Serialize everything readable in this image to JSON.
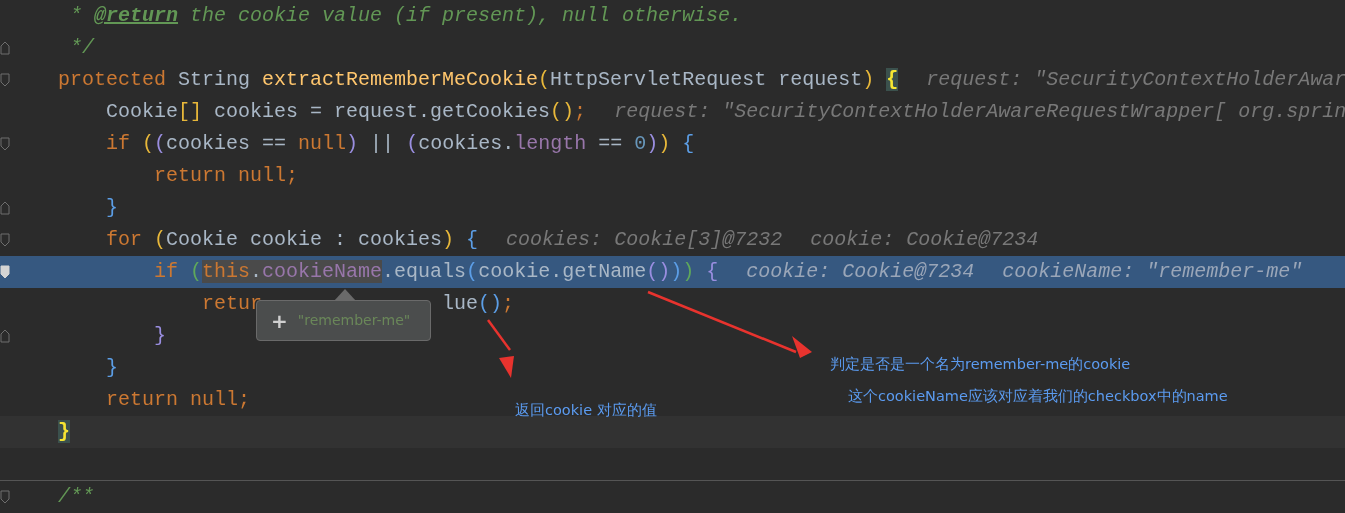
{
  "editor": {
    "lines": [
      {
        "tokens": [
          {
            "text": " * ",
            "kind": "doc"
          },
          {
            "text": "@return",
            "kind": "tag"
          },
          {
            "text": " the cookie value (if present), null otherwise.",
            "kind": "doc"
          }
        ]
      },
      {
        "fold_end": true,
        "tokens": [
          {
            "text": " */",
            "kind": "doc"
          }
        ]
      },
      {
        "fold_start": true,
        "tokens": [
          {
            "text": "protected ",
            "kind": "kw"
          },
          {
            "text": "String ",
            "kind": "pl"
          },
          {
            "text": "extractRememberMeCookie",
            "kind": "fn"
          },
          {
            "text": "(",
            "kind": "y"
          },
          {
            "text": "HttpServletRequest request",
            "kind": "pl"
          },
          {
            "text": ") ",
            "kind": "y"
          },
          {
            "text": "{",
            "kind": "match"
          }
        ],
        "hints": [
          "request: \"SecurityContextHolderAwar"
        ],
        "children": [
          {
            "tokens": [
              {
                "text": "Cookie",
                "kind": "pl"
              },
              {
                "text": "[]",
                "kind": "y"
              },
              {
                "text": " cookies = request.getCookies",
                "kind": "pl"
              },
              {
                "text": "()",
                "kind": "y"
              },
              {
                "text": ";",
                "kind": "kw"
              }
            ],
            "hints": [
              "request: \"SecurityContextHolderAwareRequestWrapper[ org.sprin"
            ]
          },
          {
            "fold_start": true,
            "tokens": [
              {
                "text": "if ",
                "kind": "kw"
              },
              {
                "text": "(",
                "kind": "y"
              },
              {
                "text": "(",
                "kind": "p"
              },
              {
                "text": "cookies == ",
                "kind": "pl"
              },
              {
                "text": "null",
                "kind": "kw"
              },
              {
                "text": ")",
                "kind": "p"
              },
              {
                "text": " || ",
                "kind": "pl"
              },
              {
                "text": "(",
                "kind": "p"
              },
              {
                "text": "cookies.",
                "kind": "pl"
              },
              {
                "text": "length",
                "kind": "fld"
              },
              {
                "text": " == ",
                "kind": "pl"
              },
              {
                "text": "0",
                "kind": "num"
              },
              {
                "text": ")",
                "kind": "p"
              },
              {
                "text": ")",
                "kind": "y"
              },
              {
                "text": " {",
                "kind": "b"
              }
            ],
            "children": [
              {
                "tokens": [
                  {
                    "text": "return null",
                    "kind": "kw"
                  },
                  {
                    "text": ";",
                    "kind": "kw"
                  }
                ]
              }
            ]
          },
          {
            "fold_end": true,
            "tokens": [
              {
                "text": "}",
                "kind": "b"
              }
            ]
          },
          {
            "fold_start": true,
            "tokens": [
              {
                "text": "for ",
                "kind": "kw"
              },
              {
                "text": "(",
                "kind": "y"
              },
              {
                "text": "Cookie cookie : cookies",
                "kind": "pl"
              },
              {
                "text": ")",
                "kind": "y"
              },
              {
                "text": " {",
                "kind": "b"
              }
            ],
            "hints": [
              "cookies: Cookie[3]@7232",
              "cookie: Cookie@7234"
            ],
            "children": [
              {
                "fold_start": true,
                "highlighted": true,
                "tokens": [
                  {
                    "text": "if ",
                    "kind": "kw"
                  },
                  {
                    "text": "(",
                    "kind": "g"
                  },
                  {
                    "text": "this",
                    "kind": "kw",
                    "hovered": true
                  },
                  {
                    "text": ".",
                    "kind": "pl",
                    "hovered": true
                  },
                  {
                    "text": "cookieName",
                    "kind": "fld",
                    "hovered": true
                  },
                  {
                    "text": ".equals",
                    "kind": "pl"
                  },
                  {
                    "text": "(",
                    "kind": "b"
                  },
                  {
                    "text": "cookie.getName",
                    "kind": "pl"
                  },
                  {
                    "text": "()",
                    "kind": "p"
                  },
                  {
                    "text": ")",
                    "kind": "b"
                  },
                  {
                    "text": ")",
                    "kind": "g"
                  },
                  {
                    "text": " {",
                    "kind": "p"
                  }
                ],
                "hints": [
                  "cookie: Cookie@7234",
                  "cookieName: \"remember-me\""
                ],
                "children": [
                  {
                    "tokens": [
                      {
                        "text": "retur",
                        "kind": "kw"
                      },
                      {
                        "kind": "gap"
                      },
                      {
                        "text": "lue",
                        "kind": "pl"
                      },
                      {
                        "text": "()",
                        "kind": "b"
                      },
                      {
                        "text": ";",
                        "kind": "kw"
                      }
                    ]
                  }
                ]
              },
              {
                "fold_end": true,
                "tokens": [
                  {
                    "text": "}",
                    "kind": "p"
                  }
                ]
              }
            ]
          },
          {
            "tokens": [
              {
                "text": "}",
                "kind": "b"
              }
            ]
          },
          {
            "tokens": [
              {
                "text": "return null",
                "kind": "kw"
              },
              {
                "text": ";",
                "kind": "kw"
              }
            ]
          }
        ]
      },
      {
        "caret": true,
        "tokens": [
          {
            "text": "}",
            "kind": "match"
          }
        ]
      },
      {
        "blank": true
      },
      {
        "separator": true,
        "fold_start": true,
        "tokens": [
          {
            "text": "/**",
            "kind": "doc"
          }
        ]
      }
    ]
  },
  "tooltip": {
    "icon": "+",
    "text": "\"remember-me\""
  },
  "annotations": [
    {
      "text": "判定是否是一个名为remember-me的cookie"
    },
    {
      "text": "这个cookieName应该对应着我们的checkbox中的name"
    },
    {
      "text": "返回cookie 对应的值"
    }
  ]
}
